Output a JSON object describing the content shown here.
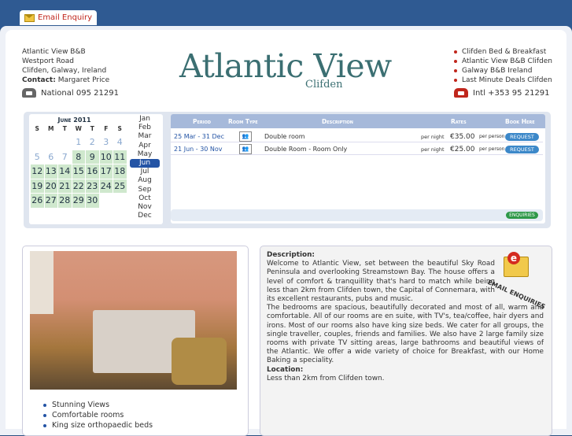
{
  "header": {
    "email_enquiry_label": "Email Enquiry"
  },
  "address": {
    "line1": "Atlantic View B&B",
    "line2": "Westport Road",
    "line3": "Clifden, Galway, Ireland",
    "contact_label": "Contact:",
    "contact_name": "Margaret Price",
    "phone": "National 095 21291"
  },
  "logo": {
    "main": "Atlantic View",
    "sub": "Clifden"
  },
  "links": [
    "Clifden Bed & Breakfast",
    "Atlantic View B&B Clifden",
    "Galway B&B Ireland",
    "Last Minute Deals Clifden"
  ],
  "intl_phone": "Intl +353 95 21291",
  "calendar": {
    "month": "June",
    "year": "2011",
    "dow": [
      "S",
      "M",
      "T",
      "W",
      "T",
      "F",
      "S"
    ],
    "months": [
      "Jan",
      "Feb",
      "Mar",
      "Apr",
      "May",
      "Jun",
      "Jul",
      "Aug",
      "Sep",
      "Oct",
      "Nov",
      "Dec"
    ],
    "selected_month": "Jun",
    "past_days": [
      "1",
      "2",
      "3",
      "4",
      "5",
      "6",
      "7"
    ],
    "avail_days": [
      "8",
      "9",
      "10",
      "11",
      "12",
      "13",
      "14",
      "15",
      "16",
      "17",
      "18",
      "19",
      "20",
      "21",
      "22",
      "23",
      "24",
      "25",
      "26",
      "27",
      "28",
      "29",
      "30"
    ]
  },
  "rates_table": {
    "headers": {
      "period": "Period",
      "room_type": "Room Type",
      "description": "Description",
      "rates": "Rates",
      "book": "Book Here"
    },
    "rows": [
      {
        "period": "25 Mar - 31 Dec",
        "description": "Double room",
        "per_night": "per night",
        "price": "€35.00",
        "per_person": "per person",
        "button": "REQUEST"
      },
      {
        "period": "21 Jun - 30 Nov",
        "description": "Double Room - Room Only",
        "per_night": "per night",
        "price": "€25.00",
        "per_person": "per person",
        "button": "REQUEST"
      }
    ],
    "enquiries_button": "ENQUIRIES"
  },
  "features": [
    "Stunning Views",
    "Comfortable rooms",
    "King size orthopaedic beds"
  ],
  "description": {
    "heading": "Description:",
    "para1": "Welcome to Atlantic View, set between the beautiful Sky Road Peninsula and overlooking Streamstown Bay. The house offers a level of comfort & tranquillity that's hard to match while being less than 2km from Clifden town, the Capital of Connemara, with its excellent restaurants, pubs and music.",
    "para2": "The bedrooms are spacious, beautifully decorated and most of all, warm and comfortable. All of our rooms are en suite, with TV's, tea/coffee, hair dyers and irons. Most of our rooms also have king size beds. We cater for all groups, the single traveller, couples, friends and families. We also have 2 large family size rooms with private TV sitting areas, large bathrooms and beautiful views of the Atlantic. We offer a wide variety of choice for Breakfast, with our Home Baking a speciality.",
    "location_heading": "Location:",
    "location_text": "Less than 2km from Clifden town."
  },
  "email_badge": {
    "letter": "e",
    "text": "EMAIL ENQUIRIES"
  }
}
